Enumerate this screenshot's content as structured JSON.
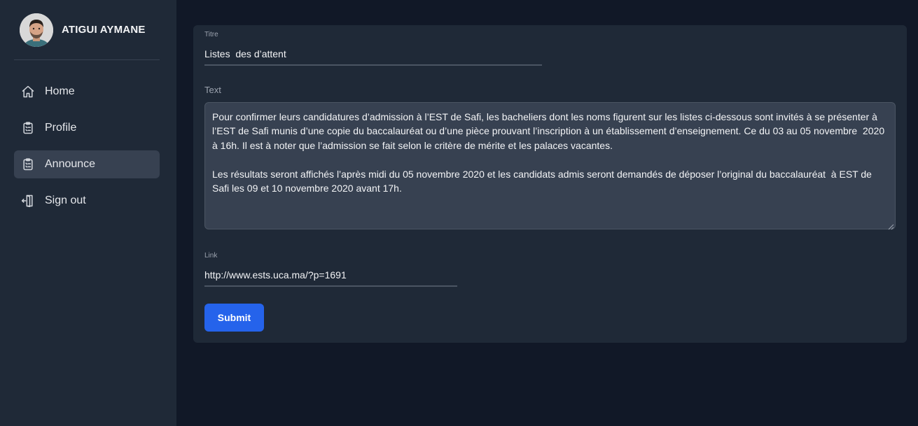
{
  "user": {
    "name": "ATIGUI AYMANE"
  },
  "nav": {
    "items": [
      {
        "label": "Home",
        "icon": "home-icon"
      },
      {
        "label": "Profile",
        "icon": "clipboard-icon"
      },
      {
        "label": "Announce",
        "icon": "clipboard-icon",
        "active": true
      },
      {
        "label": "Sign out",
        "icon": "sign-out-icon"
      }
    ]
  },
  "form": {
    "title_label": "Titre",
    "title_value": "Listes  des d’attent",
    "text_label": "Text",
    "text_value": "Pour confirmer leurs candidatures d’admission à l’EST de Safi, les bacheliers dont les noms figurent sur les listes ci-dessous sont invités à se présenter à l’EST de Safi munis d’une copie du baccalauréat ou d’une pièce prouvant l’inscription à un établissement d’enseignement. Ce du 03 au 05 novembre  2020 à 16h. Il est à noter que l’admission se fait selon le critère de mérite et les palaces vacantes.\n\nLes résultats seront affichés l’après midi du 05 novembre 2020 et les candidats admis seront demandés de déposer l’original du baccalauréat  à EST de Safi les 09 et 10 novembre 2020 avant 17h.",
    "link_label": "Link",
    "link_value": "http://www.ests.uca.ma/?p=1691",
    "submit_label": "Submit"
  },
  "colors": {
    "background": "#111827",
    "sidebar": "#1f2937",
    "card": "#1f2937",
    "active_item": "#374151",
    "accent": "#2563eb"
  }
}
